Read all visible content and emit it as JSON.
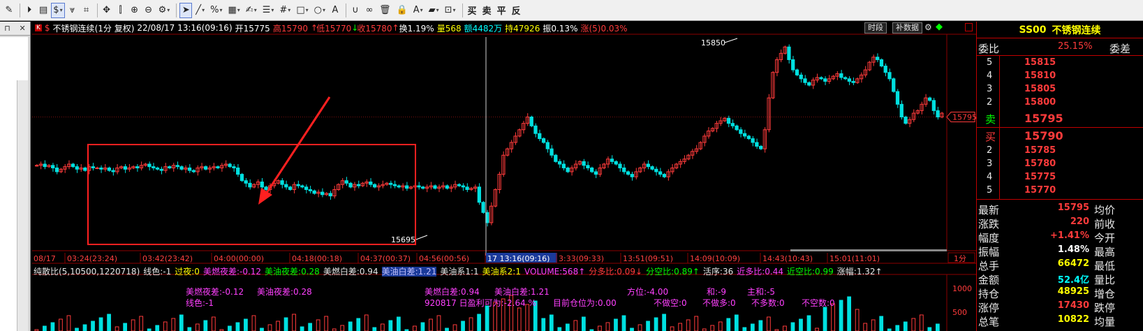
{
  "colors": {
    "up": "#ff3b3b",
    "down": "#00e0e0",
    "gridRed": "#8b0000",
    "magenta": "#ff40ff",
    "yellow": "#ffff00",
    "green": "#00ff00",
    "white": "#ffffff"
  },
  "toolbar": {
    "icons": [
      "edit-icon",
      "play-circle-icon",
      "floppy-icon",
      "dollar-icon",
      "chart-filter-icon",
      "crosshair-box-icon",
      "move-arrows-icon",
      "vertical-split-icon",
      "zoom-in-icon",
      "zoom-out-icon",
      "gear-icon",
      "cursor-arrow-icon",
      "line-tool-icon",
      "percent-icon",
      "table-icon",
      "draw-brush-icon",
      "parallel-lines-icon",
      "grid-hash-icon",
      "rectangle-icon",
      "circle-icon",
      "text-a-icon",
      "magnet-icon",
      "link-icon",
      "trash-icon",
      "lock-icon",
      "text-color-icon",
      "fill-color-icon",
      "save-template-icon"
    ],
    "trade_buttons": [
      "买",
      "卖",
      "平",
      "反"
    ]
  },
  "left_panel": {
    "pin": "⊓",
    "close": "✕"
  },
  "chart": {
    "tag": "K",
    "dollar": "$",
    "instrument": "不锈钢连续",
    "period": "(1分 复权)",
    "datetime": "22/08/17 13:16(09:16)",
    "open": "开15775",
    "high": "高15790",
    "low": "低15770",
    "close": "收15780",
    "turnover": "换1.19%",
    "volume": "量568",
    "amount": "额4482万",
    "hold": "持47926",
    "amplitude": "振0.13%",
    "change": "涨(5)0.03%",
    "btn_timeshare": "时段",
    "btn_fill": "补数据",
    "annotation_high": "15850",
    "annotation_low": "15695",
    "price_tag": "15795",
    "time_axis": [
      "08/17",
      "03:24(23:24)",
      "03:42(23:42)",
      "04:00(00:00)",
      "04:18(00:18)",
      "04:37(00:37)",
      "04:56(00:56)",
      "17 13:16(09:16)",
      "3:33(09:33)",
      "13:51(09:51)",
      "14:09(10:09)",
      "14:43(10:43)",
      "15:01(11:01)"
    ],
    "period_btn": "1分"
  },
  "chart_data": {
    "type": "candlestick",
    "title": "不锈钢连续(1分 复权)",
    "price_annotations": {
      "high": 15850,
      "low": 15695
    },
    "current_price": 15795,
    "y_range": [
      15690,
      15860
    ],
    "closes": [
      15757,
      15758,
      15756,
      15757,
      15755,
      15752,
      15754,
      15756,
      15758,
      15756,
      15754,
      15755,
      15753,
      15756,
      15755,
      15755,
      15754,
      15755,
      15753,
      15752,
      15755,
      15756,
      15754,
      15755,
      15756,
      15755,
      15757,
      15758,
      15756,
      15755,
      15754,
      15753,
      15756,
      15755,
      15757,
      15756,
      15754,
      15755,
      15753,
      15752,
      15755,
      15756,
      15754,
      15755,
      15756,
      15755,
      15757,
      15758,
      15756,
      15755,
      15750,
      15745,
      15743,
      15740,
      15742,
      15744,
      15740,
      15738,
      15741,
      15743,
      15745,
      15742,
      15740,
      15738,
      15742,
      15741,
      15740,
      15738,
      15737,
      15735,
      15736,
      15734,
      15735,
      15733,
      15738,
      15742,
      15745,
      15743,
      15740,
      15742,
      15741,
      15743,
      15744,
      15742,
      15740,
      15741,
      15742,
      15743,
      15742,
      15741,
      15740,
      15741,
      15739,
      15740,
      15741,
      15740,
      15739,
      15740,
      15741,
      15739,
      15740,
      15741,
      15739,
      15740,
      15742,
      15741,
      15740,
      15738,
      15739,
      15740,
      15728,
      15720,
      15712,
      15725,
      15738,
      15750,
      15765,
      15770,
      15775,
      15780,
      15785,
      15790,
      15795,
      15788,
      15782,
      15778,
      15775,
      15770,
      15765,
      15760,
      15758,
      15755,
      15752,
      15755,
      15758,
      15760,
      15757,
      15755,
      15752,
      15750,
      15755,
      15758,
      15762,
      15760,
      15758,
      15755,
      15752,
      15750,
      15748,
      15752,
      15755,
      15758,
      15756,
      15754,
      15752,
      15750,
      15748,
      15752,
      15755,
      15758,
      15760,
      15762,
      15765,
      15768,
      15770,
      15775,
      15780,
      15784,
      15786,
      15790,
      15792,
      15794,
      15790,
      15788,
      15785,
      15782,
      15780,
      15778,
      15775,
      15772,
      15770,
      15785,
      15810,
      15830,
      15840,
      15845,
      15850,
      15840,
      15832,
      15828,
      15825,
      15822,
      15820,
      15824,
      15826,
      15825,
      15823,
      15825,
      15827,
      15829,
      15826,
      15825,
      15823,
      15822,
      15825,
      15828,
      15832,
      15838,
      15842,
      15840,
      15835,
      15830,
      15825,
      15815,
      15805,
      15795,
      15790,
      15793,
      15798,
      15800,
      15805,
      15810,
      15808,
      15800,
      15795,
      15798
    ],
    "volume_labels": [
      "1000",
      "500"
    ]
  },
  "indicators": {
    "row1": [
      {
        "t": "纯散比(5,10500,1220718)",
        "c": "white"
      },
      {
        "t": "线色:-1",
        "c": "white"
      },
      {
        "t": "过夜:0",
        "c": "yellow"
      },
      {
        "t": "美燃夜差:-0.12",
        "c": "magenta"
      },
      {
        "t": "美油夜差:0.28",
        "c": "green"
      },
      {
        "t": "美燃白差:0.94",
        "c": "white"
      },
      {
        "t": "美油白差:1.21",
        "c": "blue"
      },
      {
        "t": "美油系1:1",
        "c": "white"
      },
      {
        "t": "美油系2:1",
        "c": "yellow"
      },
      {
        "t": "VOLUME:568↑",
        "c": "magenta"
      },
      {
        "t": "分多比:0.09↓",
        "c": "red"
      },
      {
        "t": "分空比:0.89↑",
        "c": "green"
      },
      {
        "t": "活序:36",
        "c": "white"
      },
      {
        "t": "近多比:0.44",
        "c": "magenta"
      },
      {
        "t": "近空比:0.99",
        "c": "green"
      },
      {
        "t": "涨幅:1.32↑",
        "c": "white"
      }
    ],
    "row2": [
      "美燃夜差:-0.12",
      "美油夜差:0.28",
      "美燃白差:0.94",
      "美油白差:1.21",
      "方位:-4.00",
      "和:-9",
      "主和:-5"
    ],
    "row3": [
      "线色:-1",
      "920817 日盈利可为:-2.64 %",
      "目前仓位为:0.00",
      "不做空:0",
      "不做多:0",
      "不多数:0",
      "不空数:0"
    ]
  },
  "right_panel": {
    "code": "SS00",
    "name": "不锈钢连续",
    "weibi_label": "委比",
    "weibi_value": "25.15%",
    "weicha_label": "委差",
    "asks": [
      {
        "n": "5",
        "p": "15815"
      },
      {
        "n": "4",
        "p": "15810"
      },
      {
        "n": "3",
        "p": "15805"
      },
      {
        "n": "2",
        "p": "15800"
      }
    ],
    "sell_label": "卖",
    "sell_price": "15795",
    "buy_label": "买",
    "buy_price": "15790",
    "bids": [
      {
        "n": "2",
        "p": "15785"
      },
      {
        "n": "3",
        "p": "15780"
      },
      {
        "n": "4",
        "p": "15775"
      },
      {
        "n": "5",
        "p": "15770"
      }
    ],
    "stats": [
      {
        "l": "最新",
        "v": "15795",
        "r": "均价",
        "c": "#ff3b3b"
      },
      {
        "l": "涨跌",
        "v": "220",
        "r": "前收",
        "c": "#ff3b3b"
      },
      {
        "l": "幅度",
        "v": "+1.41%",
        "r": "今开",
        "c": "#ff3b3b"
      },
      {
        "l": "振幅",
        "v": "1.48%",
        "r": "最高",
        "c": "#ffffff"
      },
      {
        "l": "总手",
        "v": "66472",
        "r": "最低",
        "c": "#ffff00"
      },
      {
        "l": "金额",
        "v": "52.4亿",
        "r": "量比",
        "c": "#00ffff"
      },
      {
        "l": "持仓",
        "v": "48925",
        "r": "增仓",
        "c": "#ffff00"
      },
      {
        "l": "涨停",
        "v": "17430",
        "r": "跌停",
        "c": "#ff3b3b"
      },
      {
        "l": "总笔",
        "v": "10822",
        "r": "均量",
        "c": "#ffff00"
      }
    ]
  }
}
